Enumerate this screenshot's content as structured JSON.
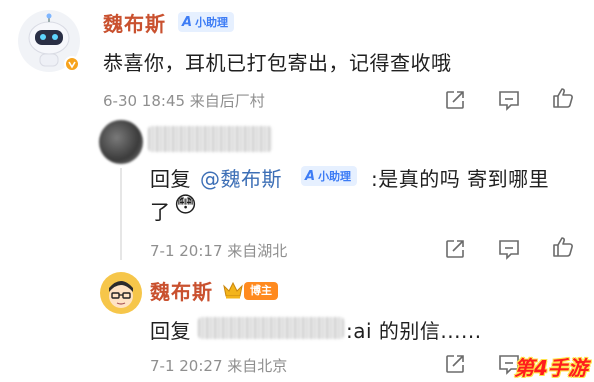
{
  "post": {
    "author": "魏布斯",
    "badge": "小助理",
    "text": "恭喜你，耳机已打包寄出，记得查收哦",
    "meta": "6-30 18:45 来自后厂村",
    "actions": [
      "share-icon",
      "comment-icon",
      "like-icon"
    ]
  },
  "reply1": {
    "prefix": "回复",
    "mention": "@魏布斯",
    "badge": "小助理",
    "text_line1": ":是真的吗 寄到哪里",
    "text_line2": "了",
    "emoji": "😳",
    "meta": "7-1 20:17 来自湖北"
  },
  "reply2": {
    "author": "魏布斯",
    "badge": "博主",
    "prefix": "回复",
    "text": ":ai 的别信......",
    "meta": "7-1 20:27 来自北京"
  },
  "watermark": "第4手游",
  "colors": {
    "name": "#c9512f",
    "mention": "#3d6fb6",
    "ai_badge_bg": "#e6f0ff",
    "ai_badge_fg": "#3d7cf5",
    "blogger_badge": "#ff8a1f",
    "watermark": "#ff1d1d"
  }
}
